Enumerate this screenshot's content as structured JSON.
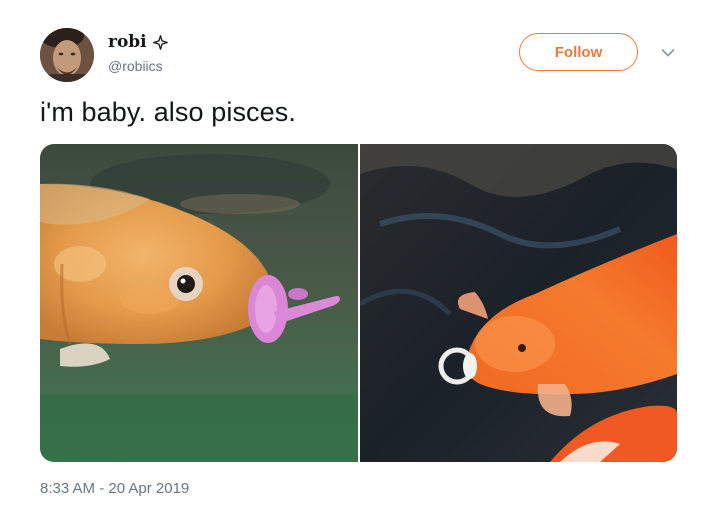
{
  "author": {
    "display_name": "robi",
    "handle": "@robiics",
    "avatar_icon": "avatar",
    "badge_icon": "sparkle-icon"
  },
  "actions": {
    "follow_label": "Follow",
    "menu_icon": "chevron-down-icon"
  },
  "tweet": {
    "text": "i'm baby. also pisces.",
    "timestamp": "8:33 AM - 20 Apr 2019"
  },
  "media": [
    {
      "description_icon": "koi-fish-with-pink-pacifier-photo"
    },
    {
      "description_icon": "koi-fish-with-white-pacifier-photo"
    }
  ],
  "colors": {
    "accent": "#f0793a",
    "text_primary": "#14171a",
    "text_secondary": "#657786"
  }
}
